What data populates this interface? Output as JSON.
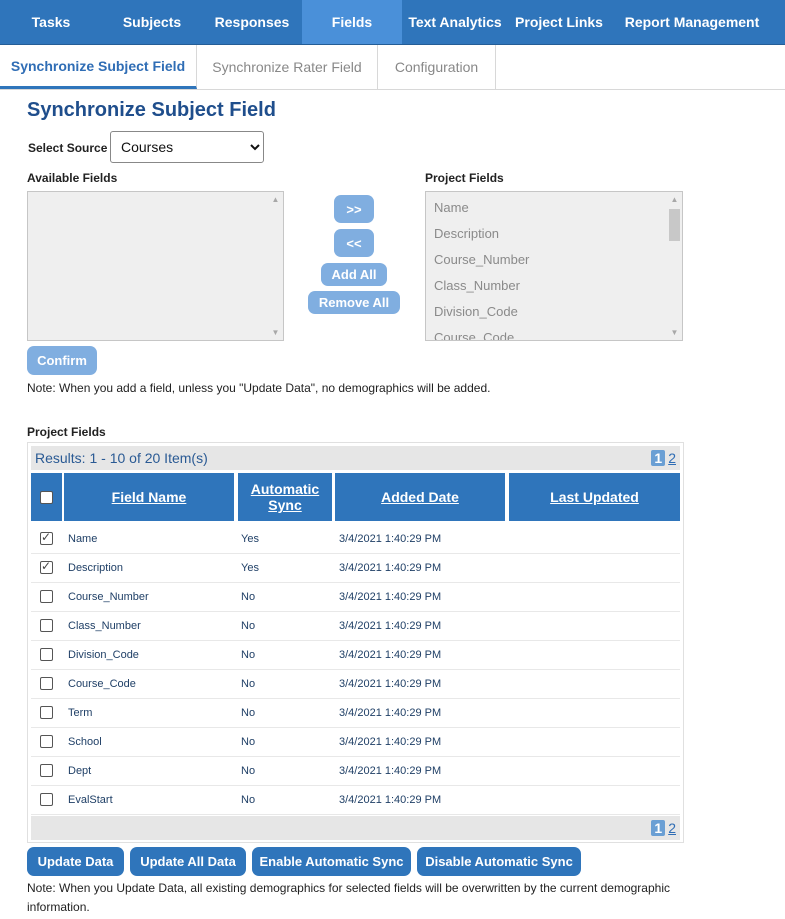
{
  "nav": {
    "items": [
      {
        "label": "Tasks",
        "active": false
      },
      {
        "label": "Subjects",
        "active": false
      },
      {
        "label": "Responses",
        "active": false
      },
      {
        "label": "Fields",
        "active": true
      },
      {
        "label": "Text Analytics",
        "active": false
      },
      {
        "label": "Project Links",
        "active": false
      },
      {
        "label": "Report Management",
        "active": false
      }
    ]
  },
  "subtabs": {
    "items": [
      {
        "label": "Synchronize Subject Field",
        "active": true
      },
      {
        "label": "Synchronize Rater Field",
        "active": false
      },
      {
        "label": "Configuration",
        "active": false
      }
    ]
  },
  "page": {
    "title": "Synchronize Subject Field",
    "select_source_label": "Select Source",
    "source_value": "Courses",
    "available_fields_label": "Available Fields",
    "project_fields_label": "Project Fields",
    "project_fields_list": [
      "Name",
      "Description",
      "Course_Number",
      "Class_Number",
      "Division_Code",
      "Course_Code"
    ],
    "btn_add": ">>",
    "btn_remove": "<<",
    "btn_add_all": "Add All",
    "btn_remove_all": "Remove All",
    "btn_confirm": "Confirm",
    "note_add": "Note: When you add a field, unless you \"Update Data\", no demographics will be added.",
    "grid_title": "Project Fields"
  },
  "grid": {
    "results_text": "Results: 1 - 10 of 20 Item(s)",
    "pages": [
      "1",
      "2"
    ],
    "current_page": "1",
    "columns": [
      "Field Name",
      "Automatic Sync",
      "Added Date",
      "Last Updated"
    ],
    "rows": [
      {
        "checked": true,
        "field": "Name",
        "sync": "Yes",
        "added": "3/4/2021 1:40:29 PM",
        "updated": ""
      },
      {
        "checked": true,
        "field": "Description",
        "sync": "Yes",
        "added": "3/4/2021 1:40:29 PM",
        "updated": ""
      },
      {
        "checked": false,
        "field": "Course_Number",
        "sync": "No",
        "added": "3/4/2021 1:40:29 PM",
        "updated": ""
      },
      {
        "checked": false,
        "field": "Class_Number",
        "sync": "No",
        "added": "3/4/2021 1:40:29 PM",
        "updated": ""
      },
      {
        "checked": false,
        "field": "Division_Code",
        "sync": "No",
        "added": "3/4/2021 1:40:29 PM",
        "updated": ""
      },
      {
        "checked": false,
        "field": "Course_Code",
        "sync": "No",
        "added": "3/4/2021 1:40:29 PM",
        "updated": ""
      },
      {
        "checked": false,
        "field": "Term",
        "sync": "No",
        "added": "3/4/2021 1:40:29 PM",
        "updated": ""
      },
      {
        "checked": false,
        "field": "School",
        "sync": "No",
        "added": "3/4/2021 1:40:29 PM",
        "updated": ""
      },
      {
        "checked": false,
        "field": "Dept",
        "sync": "No",
        "added": "3/4/2021 1:40:29 PM",
        "updated": ""
      },
      {
        "checked": false,
        "field": "EvalStart",
        "sync": "No",
        "added": "3/4/2021 1:40:29 PM",
        "updated": ""
      }
    ]
  },
  "actions": {
    "update_data": "Update Data",
    "update_all_data": "Update All Data",
    "enable_sync": "Enable Automatic Sync",
    "disable_sync": "Disable Automatic Sync",
    "note_update": "Note: When you Update Data, all existing demographics for selected fields will be overwritten by the current demographic information."
  }
}
